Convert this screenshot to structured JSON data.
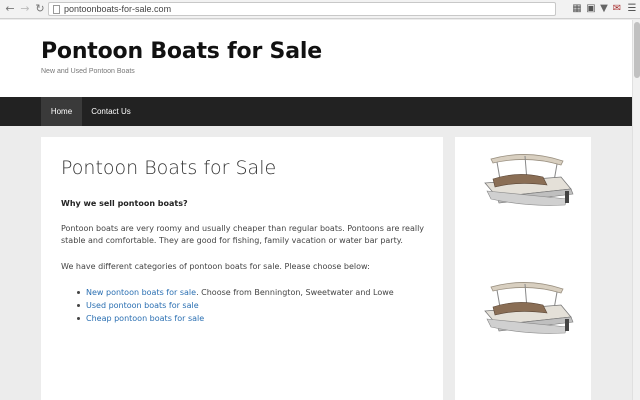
{
  "browser": {
    "url": "pontoonboats-for-sale.com"
  },
  "site": {
    "title": "Pontoon Boats for Sale",
    "tagline": "New and Used Pontoon Boats"
  },
  "nav": {
    "items": [
      {
        "label": "Home",
        "active": true
      },
      {
        "label": "Contact Us",
        "active": false
      }
    ]
  },
  "main": {
    "heading": "Pontoon Boats for Sale",
    "lead": "Why we sell pontoon boats?",
    "paragraph1": "Pontoon boats are very roomy and usually cheaper than regular boats. Pontoons are really stable and comfortable. They are good for fishing, family vacation or water bar party.",
    "paragraph2": "We have different categories of pontoon boats for sale. Please choose below:",
    "categories": [
      {
        "link": "New pontoon boats for sale",
        "suffix": ". Choose from Bennington, Sweetwater and Lowe"
      },
      {
        "link": "Used pontoon boats for sale",
        "suffix": ""
      },
      {
        "link": "Cheap pontoon boats for sale",
        "suffix": ""
      }
    ]
  },
  "colors": {
    "link": "#2a6fb2",
    "navbar": "#222222",
    "nav_active": "#3a3a3a"
  }
}
